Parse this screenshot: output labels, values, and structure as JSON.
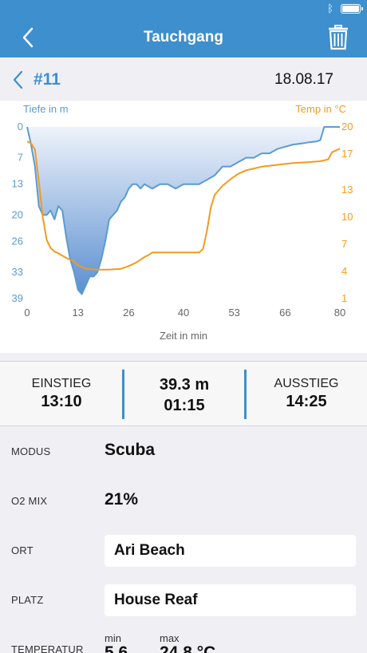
{
  "status": {
    "bluetooth_icon": "bluetooth-icon",
    "battery_icon": "battery-icon"
  },
  "nav": {
    "title": "Tauchgang",
    "back_icon": "chevron-left-icon",
    "delete_icon": "trash-icon"
  },
  "dive": {
    "number": "#11",
    "date": "18.08.17"
  },
  "chart_data": {
    "type": "line",
    "xlabel": "Zeit in min",
    "ylabel_left": "Tiefe in m",
    "ylabel_right": "Temp in °C",
    "x_ticks": [
      "0",
      "13",
      "26",
      "40",
      "53",
      "66",
      "80"
    ],
    "y_left_ticks": [
      "0",
      "7",
      "13",
      "20",
      "26",
      "33",
      "39"
    ],
    "y_right_ticks": [
      "20",
      "17",
      "13",
      "10",
      "7",
      "4",
      "1"
    ],
    "xlim": [
      0,
      80
    ],
    "ylim_depth": [
      0,
      39
    ],
    "ylim_temp": [
      1,
      20
    ],
    "colors": {
      "depth": "#5b9bd0",
      "temp": "#f39a1f"
    },
    "series": [
      {
        "key": "depth",
        "x": [
          0,
          0.5,
          1,
          2,
          3,
          4,
          5,
          6,
          7,
          8,
          9,
          10,
          11,
          12,
          13,
          14,
          15,
          16,
          17,
          18,
          19,
          20,
          21,
          22,
          23,
          24,
          25,
          26,
          27,
          28,
          29,
          30,
          32,
          34,
          36,
          38,
          40,
          42,
          44,
          46,
          48,
          50,
          52,
          54,
          56,
          58,
          60,
          62,
          64,
          66,
          68,
          70,
          72,
          74,
          75,
          76,
          78,
          80
        ],
        "y": [
          0,
          2,
          4,
          9,
          18,
          20,
          20,
          19,
          21,
          18,
          19,
          25,
          30,
          33,
          37,
          38,
          36,
          34,
          34,
          33,
          30,
          26,
          21,
          20,
          19,
          17,
          16,
          14,
          13,
          13,
          14,
          13,
          14,
          13,
          13,
          14,
          13,
          13,
          13,
          12,
          11,
          9,
          9,
          8,
          7,
          7,
          6,
          6,
          5,
          4.5,
          4,
          3.8,
          3.5,
          3.3,
          3,
          0,
          0,
          0
        ]
      },
      {
        "key": "temp",
        "x": [
          0,
          1,
          2,
          3,
          4,
          5,
          6,
          7,
          8,
          10,
          12,
          13,
          15,
          18,
          21,
          24,
          26,
          28,
          30,
          31,
          32,
          34,
          36,
          38,
          40,
          42,
          43,
          44,
          45,
          46,
          47,
          48,
          50,
          52,
          54,
          56,
          58,
          60,
          64,
          68,
          72,
          75,
          77,
          78,
          80
        ],
        "y": [
          18.4,
          18.2,
          17.5,
          14,
          10,
          7.5,
          6.6,
          6.2,
          6.0,
          5.5,
          5.1,
          4.7,
          4.3,
          4.2,
          4.2,
          4.3,
          4.6,
          5.0,
          5.6,
          5.8,
          6.1,
          6.1,
          6.1,
          6.1,
          6.1,
          6.1,
          6.1,
          6.1,
          6.5,
          8.5,
          11.1,
          12.5,
          13.5,
          14.2,
          14.8,
          15.2,
          15.4,
          15.6,
          15.8,
          16.0,
          16.1,
          16.2,
          16.4,
          17.2,
          17.6
        ]
      }
    ]
  },
  "summary": {
    "entry_label": "EINSTIEG",
    "entry_time": "13:10",
    "max_depth": "39.3 m",
    "duration": "01:15",
    "exit_label": "AUSSTIEG",
    "exit_time": "14:25"
  },
  "details": {
    "mode_label": "MODUS",
    "mode_value": "Scuba",
    "o2_label": "O2 MIX",
    "o2_value": "21%",
    "location_label": "ORT",
    "location_value": "Ari Beach",
    "site_label": "PLATZ",
    "site_value": "House Reaf",
    "temp_label": "TEMPERATUR",
    "temp_min_label": "min",
    "temp_min_value": "5.6",
    "temp_max_label": "max",
    "temp_max_value": "24.8 °C"
  }
}
